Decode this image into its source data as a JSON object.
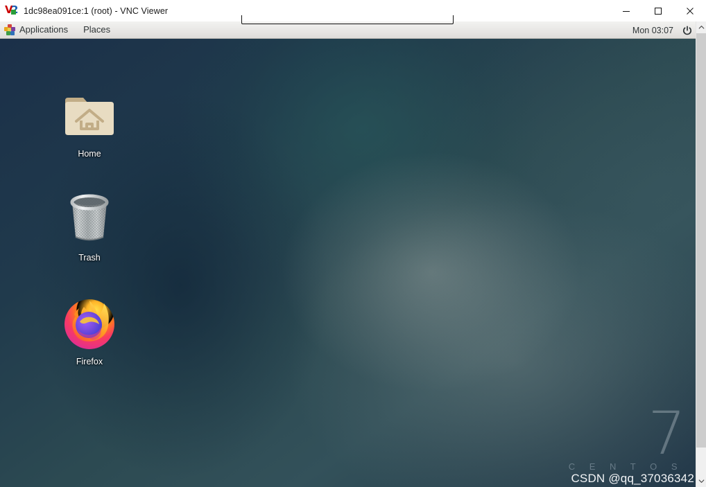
{
  "window": {
    "title": "1dc98ea091ce:1 (root) - VNC Viewer",
    "logo_icon": "vnc-logo-icon",
    "controls": [
      {
        "name": "minimize-button",
        "icon": "minimize-icon",
        "label": "Minimize"
      },
      {
        "name": "maximize-button",
        "icon": "maximize-icon",
        "label": "Maximize"
      },
      {
        "name": "close-button",
        "icon": "close-icon",
        "label": "Close"
      }
    ],
    "toolbar_handle_label": "VNC toolbar handle"
  },
  "panel": {
    "applications_icon": "gnome-applications-icon",
    "applications_label": "Applications",
    "places_label": "Places",
    "clock": "Mon 03:07",
    "power_icon": "power-icon"
  },
  "desktop": {
    "icons": [
      {
        "name": "home",
        "label": "Home",
        "icon": "home-folder-icon"
      },
      {
        "name": "trash",
        "label": "Trash",
        "icon": "trash-bin-icon"
      },
      {
        "name": "firefox",
        "label": "Firefox",
        "icon": "firefox-icon"
      }
    ],
    "branding": {
      "version": "7",
      "name": "C E N T O S"
    },
    "watermark": "CSDN @qq_37036342"
  },
  "scrollbar": {
    "up_icon": "chevron-up-icon",
    "down_icon": "chevron-down-icon",
    "thumb_name": "scrollbar-thumb"
  },
  "colors": {
    "panel_text": "#2e3436",
    "desktop_base": "#203a4c",
    "icon_label": "#ffffff",
    "vnc_red": "#cc0000",
    "vnc_blue": "#1a5fb4",
    "vnc_green": "#2a9d3a",
    "scrollbar_thumb": "#cdcdcd"
  }
}
